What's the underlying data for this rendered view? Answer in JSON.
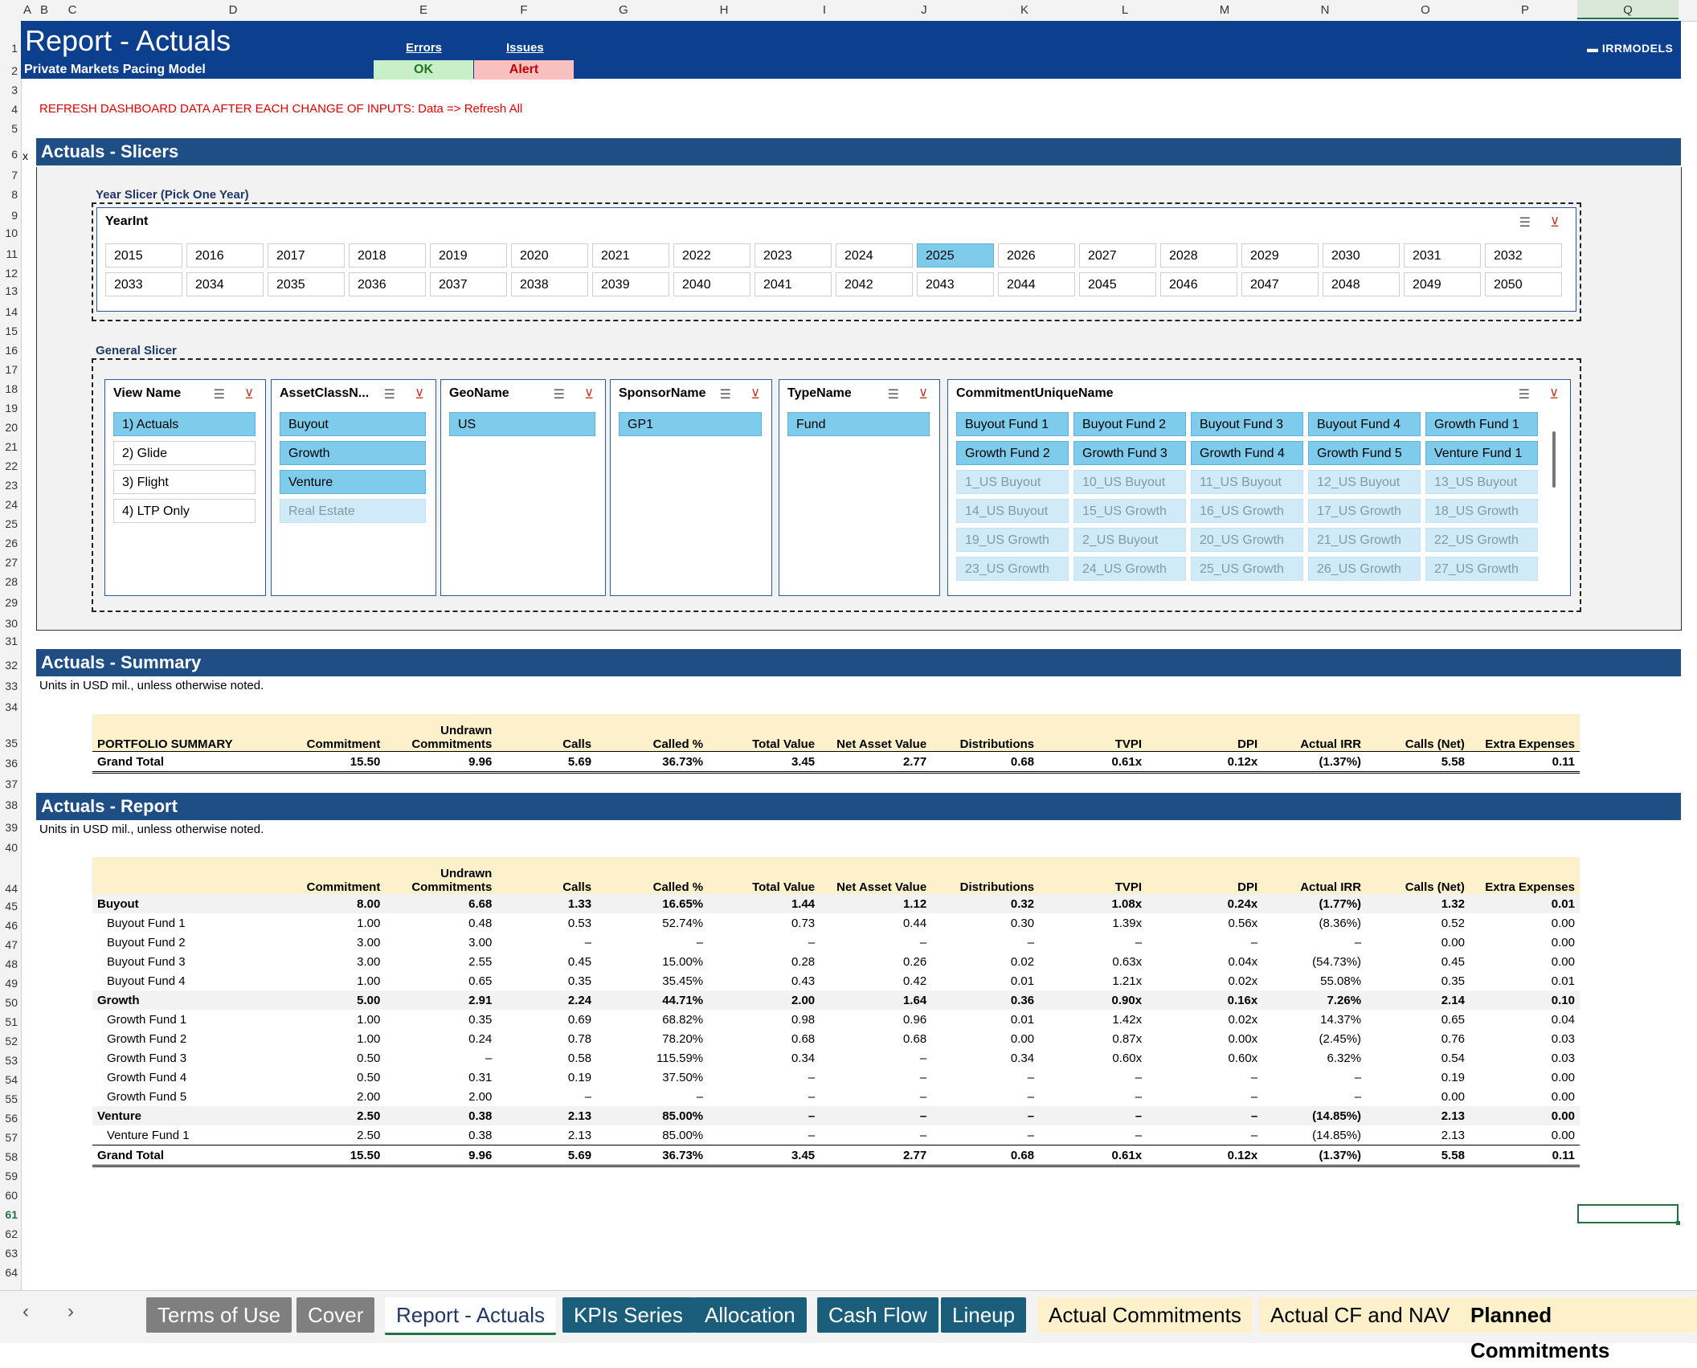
{
  "columns": [
    "A",
    "B",
    "C",
    "D",
    "E",
    "F",
    "G",
    "H",
    "I",
    "J",
    "K",
    "L",
    "M",
    "N",
    "O",
    "P",
    "Q"
  ],
  "selected_column": "Q",
  "selected_row": "61",
  "rows": [
    "1",
    "2",
    "3",
    "4",
    "5",
    "6",
    "7",
    "8",
    "9",
    "10",
    "11",
    "12",
    "13",
    "14",
    "15",
    "16",
    "17",
    "18",
    "19",
    "20",
    "21",
    "22",
    "23",
    "24",
    "25",
    "26",
    "27",
    "28",
    "29",
    "30",
    "31",
    "32",
    "33",
    "34",
    "35",
    "36",
    "37",
    "38",
    "39",
    "40",
    "44",
    "45",
    "46",
    "47",
    "48",
    "49",
    "50",
    "51",
    "52",
    "53",
    "54",
    "55",
    "56",
    "57",
    "58",
    "59",
    "60",
    "61",
    "62",
    "63",
    "64"
  ],
  "header": {
    "title": "Report - Actuals",
    "subtitle": "Private Markets Pacing Model",
    "errors_label": "Errors",
    "issues_label": "Issues",
    "errors_status": "OK",
    "issues_status": "Alert",
    "brand": "IRRMODELS"
  },
  "refresh_note": "REFRESH DASHBOARD DATA AFTER EACH CHANGE OF INPUTS: Data => Refresh All",
  "row_marker": "x",
  "sections": {
    "slicers": "Actuals - Slicers",
    "summary": "Actuals - Summary",
    "report": "Actuals - Report"
  },
  "units_note": "Units in USD mil., unless otherwise noted.",
  "year_slicer": {
    "group_label": "Year Slicer (Pick One Year)",
    "title": "YearInt",
    "years": [
      "2015",
      "2016",
      "2017",
      "2018",
      "2019",
      "2020",
      "2021",
      "2022",
      "2023",
      "2024",
      "2025",
      "2026",
      "2027",
      "2028",
      "2029",
      "2030",
      "2031",
      "2032",
      "2033",
      "2034",
      "2035",
      "2036",
      "2037",
      "2038",
      "2039",
      "2040",
      "2041",
      "2042",
      "2043",
      "2044",
      "2045",
      "2046",
      "2047",
      "2048",
      "2049",
      "2050"
    ],
    "selected": "2025"
  },
  "general_slicer": {
    "group_label": "General Slicer",
    "slicers": [
      {
        "title": "View Name",
        "items": [
          {
            "label": "1) Actuals",
            "state": "on"
          },
          {
            "label": "2) Glide",
            "state": "off"
          },
          {
            "label": "3) Flight",
            "state": "off"
          },
          {
            "label": "4) LTP Only",
            "state": "off"
          }
        ]
      },
      {
        "title": "AssetClassN...",
        "items": [
          {
            "label": "Buyout",
            "state": "on"
          },
          {
            "label": "Growth",
            "state": "on"
          },
          {
            "label": "Venture",
            "state": "on"
          },
          {
            "label": "Real Estate",
            "state": "dim"
          }
        ]
      },
      {
        "title": "GeoName",
        "items": [
          {
            "label": "US",
            "state": "on"
          }
        ]
      },
      {
        "title": "SponsorName",
        "items": [
          {
            "label": "GP1",
            "state": "on"
          }
        ]
      },
      {
        "title": "TypeName",
        "items": [
          {
            "label": "Fund",
            "state": "on"
          }
        ]
      }
    ],
    "commitment": {
      "title": "CommitmentUniqueName",
      "items": [
        {
          "label": "Buyout Fund 1",
          "state": "on"
        },
        {
          "label": "Buyout Fund 2",
          "state": "on"
        },
        {
          "label": "Buyout Fund 3",
          "state": "on"
        },
        {
          "label": "Buyout Fund 4",
          "state": "on"
        },
        {
          "label": "Growth Fund 1",
          "state": "on"
        },
        {
          "label": "Growth Fund 2",
          "state": "on"
        },
        {
          "label": "Growth Fund 3",
          "state": "on"
        },
        {
          "label": "Growth Fund 4",
          "state": "on"
        },
        {
          "label": "Growth Fund 5",
          "state": "on"
        },
        {
          "label": "Venture Fund 1",
          "state": "on"
        },
        {
          "label": "1_US Buyout",
          "state": "dim"
        },
        {
          "label": "10_US Buyout",
          "state": "dim"
        },
        {
          "label": "11_US Buyout",
          "state": "dim"
        },
        {
          "label": "12_US Buyout",
          "state": "dim"
        },
        {
          "label": "13_US Buyout",
          "state": "dim"
        },
        {
          "label": "14_US Buyout",
          "state": "dim"
        },
        {
          "label": "15_US Growth",
          "state": "dim"
        },
        {
          "label": "16_US Growth",
          "state": "dim"
        },
        {
          "label": "17_US Growth",
          "state": "dim"
        },
        {
          "label": "18_US Growth",
          "state": "dim"
        },
        {
          "label": "19_US Growth",
          "state": "dim"
        },
        {
          "label": "2_US Buyout",
          "state": "dim"
        },
        {
          "label": "20_US Growth",
          "state": "dim"
        },
        {
          "label": "21_US Growth",
          "state": "dim"
        },
        {
          "label": "22_US Growth",
          "state": "dim"
        },
        {
          "label": "23_US Growth",
          "state": "dim"
        },
        {
          "label": "24_US Growth",
          "state": "dim"
        },
        {
          "label": "25_US Growth",
          "state": "dim"
        },
        {
          "label": "26_US Growth",
          "state": "dim"
        },
        {
          "label": "27_US Growth",
          "state": "dim"
        }
      ]
    }
  },
  "table_headers": [
    "Commitment",
    "Undrawn Commitments",
    "Calls",
    "Called %",
    "Total Value",
    "Net Asset Value",
    "Distributions",
    "TVPI",
    "DPI",
    "Actual IRR",
    "Calls (Net)",
    "Extra Expenses"
  ],
  "summary": {
    "label": "PORTFOLIO SUMMARY",
    "rows": [
      {
        "label": "Grand Total",
        "kind": "total",
        "values": [
          "15.50",
          "9.96",
          "5.69",
          "36.73%",
          "3.45",
          "2.77",
          "0.68",
          "0.61x",
          "0.12x",
          "(1.37%)",
          "5.58",
          "0.11"
        ]
      }
    ]
  },
  "report": {
    "rows": [
      {
        "label": "Buyout",
        "kind": "grp",
        "values": [
          "8.00",
          "6.68",
          "1.33",
          "16.65%",
          "1.44",
          "1.12",
          "0.32",
          "1.08x",
          "0.24x",
          "(1.77%)",
          "1.32",
          "0.01"
        ]
      },
      {
        "label": "Buyout Fund 1",
        "kind": "sub",
        "values": [
          "1.00",
          "0.48",
          "0.53",
          "52.74%",
          "0.73",
          "0.44",
          "0.30",
          "1.39x",
          "0.56x",
          "(8.36%)",
          "0.52",
          "0.00"
        ]
      },
      {
        "label": "Buyout Fund 2",
        "kind": "sub",
        "values": [
          "3.00",
          "3.00",
          "–",
          "–",
          "–",
          "–",
          "–",
          "–",
          "–",
          "–",
          "0.00",
          "0.00"
        ]
      },
      {
        "label": "Buyout Fund 3",
        "kind": "sub",
        "values": [
          "3.00",
          "2.55",
          "0.45",
          "15.00%",
          "0.28",
          "0.26",
          "0.02",
          "0.63x",
          "0.04x",
          "(54.73%)",
          "0.45",
          "0.00"
        ]
      },
      {
        "label": "Buyout Fund 4",
        "kind": "sub",
        "values": [
          "1.00",
          "0.65",
          "0.35",
          "35.45%",
          "0.43",
          "0.42",
          "0.01",
          "1.21x",
          "0.02x",
          "55.08%",
          "0.35",
          "0.01"
        ]
      },
      {
        "label": "Growth",
        "kind": "grp",
        "values": [
          "5.00",
          "2.91",
          "2.24",
          "44.71%",
          "2.00",
          "1.64",
          "0.36",
          "0.90x",
          "0.16x",
          "7.26%",
          "2.14",
          "0.10"
        ]
      },
      {
        "label": "Growth Fund 1",
        "kind": "sub",
        "values": [
          "1.00",
          "0.35",
          "0.69",
          "68.82%",
          "0.98",
          "0.96",
          "0.01",
          "1.42x",
          "0.02x",
          "14.37%",
          "0.65",
          "0.04"
        ]
      },
      {
        "label": "Growth Fund 2",
        "kind": "sub",
        "values": [
          "1.00",
          "0.24",
          "0.78",
          "78.20%",
          "0.68",
          "0.68",
          "0.00",
          "0.87x",
          "0.00x",
          "(2.45%)",
          "0.76",
          "0.03"
        ]
      },
      {
        "label": "Growth Fund 3",
        "kind": "sub",
        "values": [
          "0.50",
          "–",
          "0.58",
          "115.59%",
          "0.34",
          "–",
          "0.34",
          "0.60x",
          "0.60x",
          "6.32%",
          "0.54",
          "0.03"
        ]
      },
      {
        "label": "Growth Fund 4",
        "kind": "sub",
        "values": [
          "0.50",
          "0.31",
          "0.19",
          "37.50%",
          "–",
          "–",
          "–",
          "–",
          "–",
          "–",
          "0.19",
          "0.00"
        ]
      },
      {
        "label": "Growth Fund 5",
        "kind": "sub",
        "values": [
          "2.00",
          "2.00",
          "–",
          "–",
          "–",
          "–",
          "–",
          "–",
          "–",
          "–",
          "0.00",
          "0.00"
        ]
      },
      {
        "label": "Venture",
        "kind": "grp",
        "values": [
          "2.50",
          "0.38",
          "2.13",
          "85.00%",
          "–",
          "–",
          "–",
          "–",
          "–",
          "(14.85%)",
          "2.13",
          "0.00"
        ]
      },
      {
        "label": "Venture Fund 1",
        "kind": "sub",
        "values": [
          "2.50",
          "0.38",
          "2.13",
          "85.00%",
          "–",
          "–",
          "–",
          "–",
          "–",
          "(14.85%)",
          "2.13",
          "0.00"
        ]
      },
      {
        "label": "Grand Total",
        "kind": "total",
        "values": [
          "15.50",
          "9.96",
          "5.69",
          "36.73%",
          "3.45",
          "2.77",
          "0.68",
          "0.61x",
          "0.12x",
          "(1.37%)",
          "5.58",
          "0.11"
        ]
      }
    ]
  },
  "tabs": [
    {
      "label": "Terms of Use",
      "style": "gray"
    },
    {
      "label": "Cover",
      "style": "gray"
    },
    {
      "label": "Report - Actuals",
      "style": "active"
    },
    {
      "label": "KPIs Series",
      "style": "teal"
    },
    {
      "label": "Allocation",
      "style": "teal"
    },
    {
      "label": "Cash Flow",
      "style": "teal"
    },
    {
      "label": "Lineup",
      "style": "teal"
    },
    {
      "label": "Actual Commitments",
      "style": "yellow"
    },
    {
      "label": "Actual CF and NAV",
      "style": "yellow"
    },
    {
      "label": "Planned Commitments",
      "style": "yellow bold"
    }
  ],
  "icons": {
    "prev": "chevron-left-icon",
    "next": "chevron-right-icon",
    "multiselect": "multiselect-icon",
    "clear": "clear-filter-icon"
  },
  "colors": {
    "banner": "#0d3f8f",
    "section": "#1f4e85",
    "slicer_selected": "#7ecbeb",
    "header_fill": "#fdf1cc"
  }
}
